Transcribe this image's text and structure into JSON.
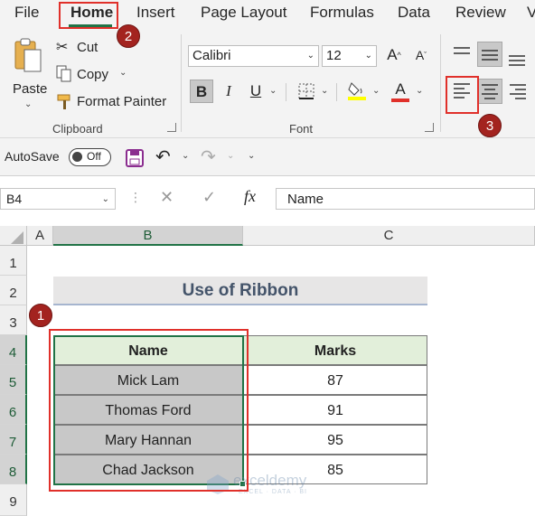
{
  "tabs": [
    "File",
    "Home",
    "Insert",
    "Page Layout",
    "Formulas",
    "Data",
    "Review",
    "V"
  ],
  "clipboard": {
    "paste_label": "Paste",
    "cut_label": "Cut",
    "copy_label": "Copy",
    "format_painter_label": "Format Painter",
    "group_label": "Clipboard"
  },
  "font": {
    "name": "Calibri",
    "size": "12",
    "bold": "B",
    "italic": "I",
    "underline": "U",
    "font_color_glyph": "A",
    "increase_glyph": "A",
    "decrease_glyph": "A",
    "group_label": "Font"
  },
  "qat": {
    "autosave_label": "AutoSave",
    "toggle_state": "Off"
  },
  "formula_bar": {
    "name_box": "B4",
    "fx": "fx",
    "content": "Name"
  },
  "sheet": {
    "columns": [
      "A",
      "B",
      "C"
    ],
    "rows": [
      "1",
      "2",
      "3",
      "4",
      "5",
      "6",
      "7",
      "8",
      "9"
    ],
    "title": "Use of Ribbon",
    "table_headers": [
      "Name",
      "Marks"
    ],
    "table_rows": [
      [
        "Mick Lam",
        "87"
      ],
      [
        "Thomas Ford",
        "91"
      ],
      [
        "Mary Hannan",
        "95"
      ],
      [
        "Chad Jackson",
        "85"
      ]
    ]
  },
  "badges": [
    "1",
    "2",
    "3"
  ],
  "watermark": {
    "name": "exceldemy",
    "tagline": "EXCEL · DATA · BI"
  },
  "colors": {
    "excel_green": "#217346",
    "highlight_yellow": "#ffff00",
    "font_red": "#e0302a",
    "header_fill": "#e2efda",
    "selection_gray": "#c8c8c8",
    "badge_red": "#a3231f",
    "title_blue": "#44546a"
  }
}
